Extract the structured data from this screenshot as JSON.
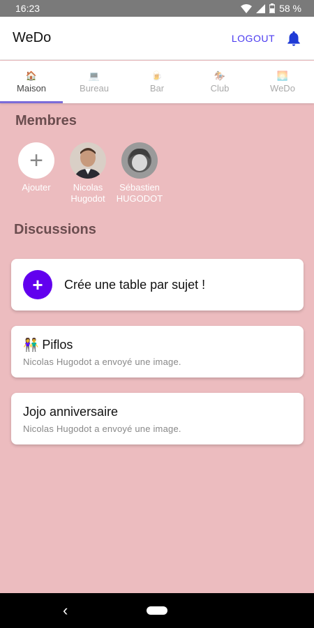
{
  "status": {
    "time": "16:23",
    "battery": "58 %"
  },
  "app": {
    "title": "WeDo",
    "logout": "LOGOUT"
  },
  "tabs": [
    {
      "label": "Maison",
      "emoji": "🏠",
      "active": true
    },
    {
      "label": "Bureau",
      "emoji": "💻",
      "active": false
    },
    {
      "label": "Bar",
      "emoji": "🍺",
      "active": false
    },
    {
      "label": "Club",
      "emoji": "🏇",
      "active": false
    },
    {
      "label": "WeDo",
      "emoji": "🌅",
      "active": false
    }
  ],
  "members_section": {
    "title": "Membres",
    "add_label": "Ajouter",
    "members": [
      {
        "name_line1": "Nicolas",
        "name_line2": "Hugodot"
      },
      {
        "name_line1": "Sébastien",
        "name_line2": "HUGODOT"
      }
    ]
  },
  "discussions_section": {
    "title": "Discussions",
    "create_label": "Crée une table par sujet !",
    "create_icon": "+",
    "chats": [
      {
        "title": "👫 Piflos",
        "subtitle": "Nicolas Hugodot a envoyé une image."
      },
      {
        "title": "Jojo anniversaire",
        "subtitle": "Nicolas Hugodot a envoyé une image."
      }
    ]
  },
  "navbar": {
    "back_icon": "‹"
  },
  "colors": {
    "background": "#ecbcbf",
    "accent": "#6200ee",
    "logout": "#4a3af0",
    "bell": "#1f3bd6"
  }
}
